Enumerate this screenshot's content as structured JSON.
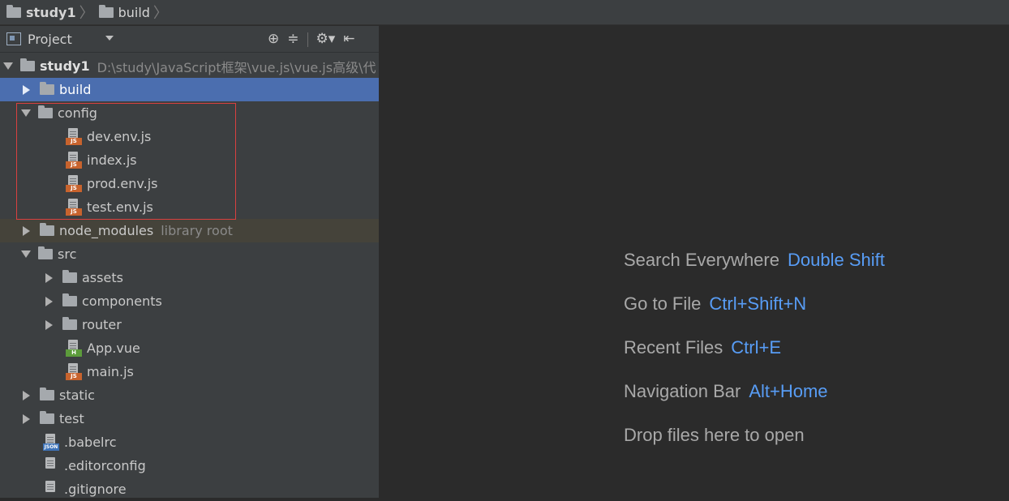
{
  "breadcrumb": {
    "items": [
      "study1",
      "build"
    ]
  },
  "project_panel": {
    "title": "Project",
    "tools": [
      "crosshair-icon",
      "collapse-icon",
      "gear-icon",
      "hide-icon"
    ]
  },
  "tree": {
    "root": {
      "name": "study1",
      "path": "D:\\study\\JavaScript框架\\vue.js\\vue.js高级\\代"
    },
    "build": "build",
    "config": "config",
    "config_files": [
      "dev.env.js",
      "index.js",
      "prod.env.js",
      "test.env.js"
    ],
    "node_modules": "node_modules",
    "node_modules_hint": "library root",
    "src": "src",
    "src_folders": [
      "assets",
      "components",
      "router"
    ],
    "src_files": [
      "App.vue",
      "main.js"
    ],
    "static": "static",
    "test": "test",
    "root_files": [
      ".babelrc",
      ".editorconfig",
      ".gitignore"
    ],
    "file_tags": {
      "js": "JS",
      "vue": "H",
      "json": "JSON"
    }
  },
  "editor_tips": [
    {
      "label": "Search Everywhere",
      "key": "Double Shift"
    },
    {
      "label": "Go to File",
      "key": "Ctrl+Shift+N"
    },
    {
      "label": "Recent Files",
      "key": "Ctrl+E"
    },
    {
      "label": "Navigation Bar",
      "key": "Alt+Home"
    },
    {
      "label": "Drop files here to open",
      "key": ""
    }
  ],
  "colors": {
    "selection": "#4b6eaf",
    "shortcut": "#589df6",
    "annotation": "#d94040"
  }
}
